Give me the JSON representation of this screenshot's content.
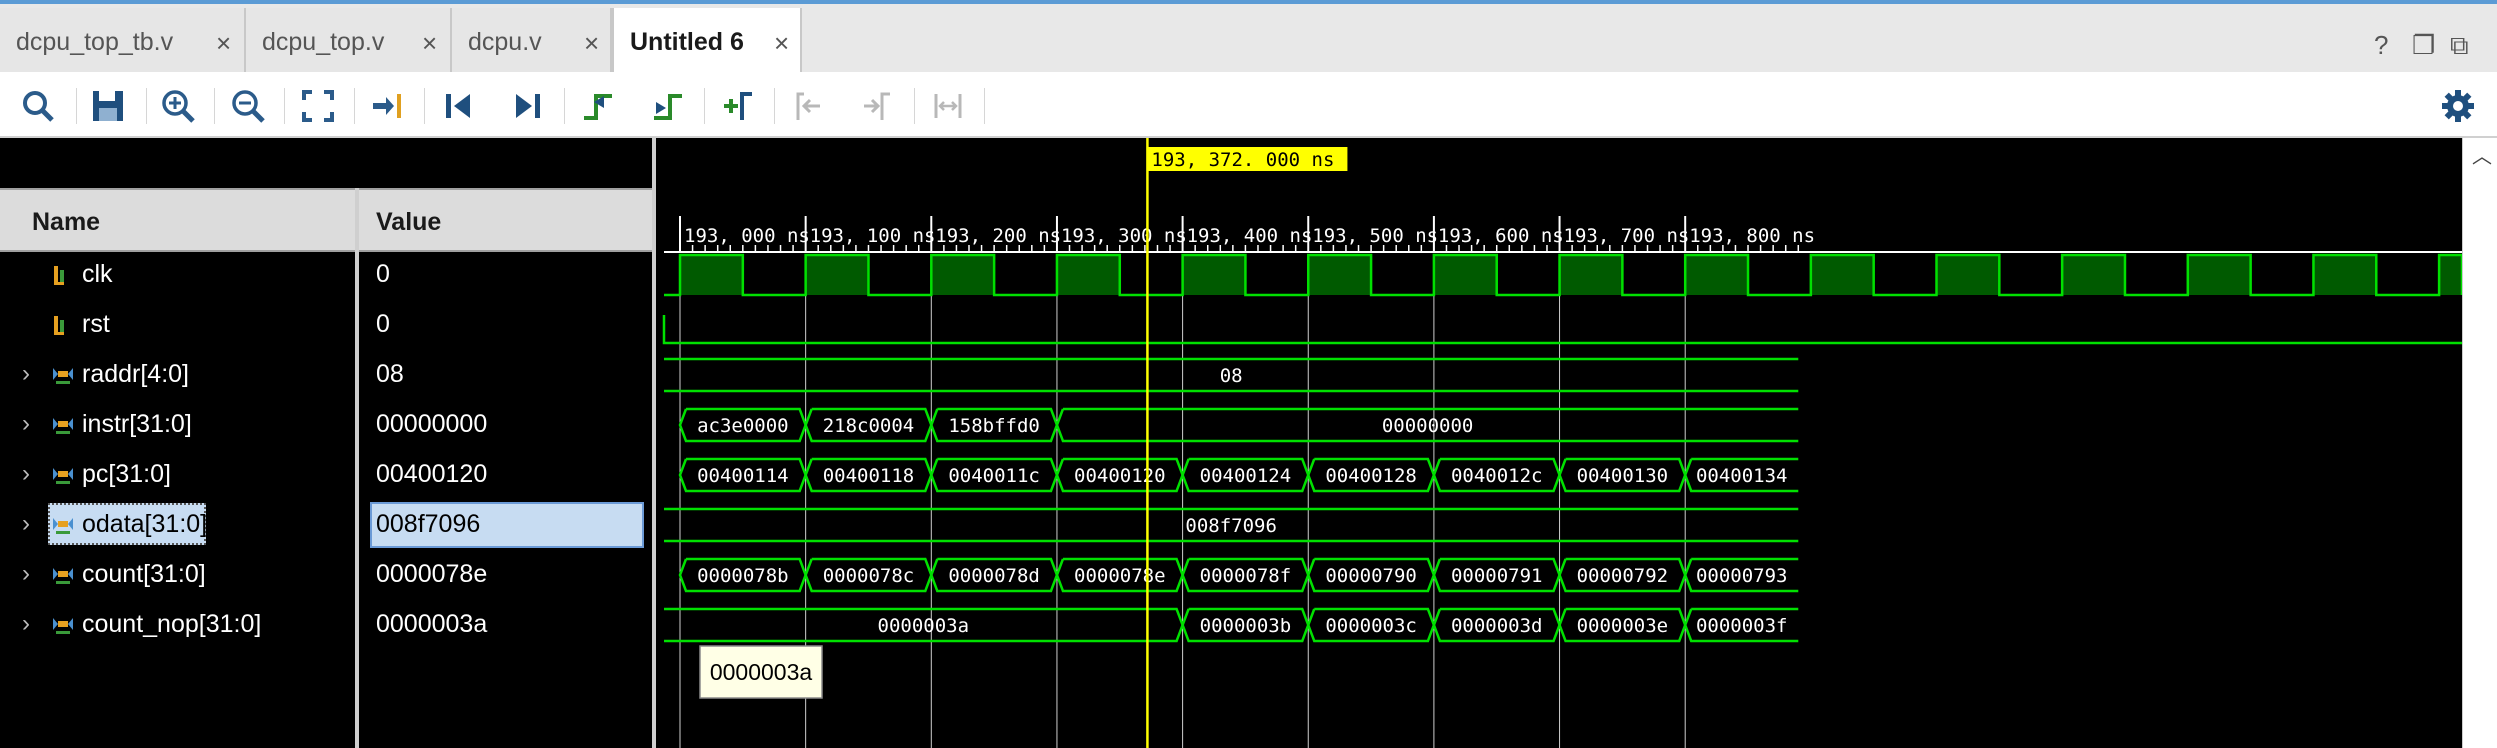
{
  "tabs": [
    {
      "label": "dcpu_top_tb.v",
      "active": false
    },
    {
      "label": "dcpu_top.v",
      "active": false
    },
    {
      "label": "dcpu.v",
      "active": false
    },
    {
      "label": "Untitled 6",
      "active": true
    }
  ],
  "tab_close_glyph": "×",
  "window_controls": {
    "help": "?",
    "restore": "❐",
    "float": "⧉"
  },
  "toolbar": [
    "search-icon",
    "save-icon",
    "zoom-in-icon",
    "zoom-out-icon",
    "zoom-fit-icon",
    "go-to-cursor-icon",
    "go-to-time-zero-icon",
    "go-to-last-time-icon",
    "previous-transition-icon",
    "next-transition-icon",
    "add-marker-icon",
    "previous-marker-icon",
    "next-marker-icon",
    "swap-cursors-icon",
    "settings-gear-icon"
  ],
  "columns": {
    "name": "Name",
    "value": "Value"
  },
  "signals": [
    {
      "name": "clk",
      "value": "0",
      "type": "bit",
      "expandable": false
    },
    {
      "name": "rst",
      "value": "0",
      "type": "bit",
      "expandable": false
    },
    {
      "name": "raddr[4:0]",
      "value": "08",
      "type": "bus",
      "expandable": true
    },
    {
      "name": "instr[31:0]",
      "value": "00000000",
      "type": "bus",
      "expandable": true
    },
    {
      "name": "pc[31:0]",
      "value": "00400120",
      "type": "bus",
      "expandable": true
    },
    {
      "name": "odata[31:0]",
      "value": "008f7096",
      "type": "bus",
      "expandable": true,
      "selected": true
    },
    {
      "name": "count[31:0]",
      "value": "0000078e",
      "type": "bus",
      "expandable": true
    },
    {
      "name": "count_nop[31:0]",
      "value": "0000003a",
      "type": "bus",
      "expandable": true
    }
  ],
  "timeline": {
    "unit": "ns",
    "ticks": [
      "193, 000 ns",
      "193, 100 ns",
      "193, 200 ns",
      "193, 300 ns",
      "193, 400 ns",
      "193, 500 ns",
      "193, 600 ns",
      "193, 700 ns",
      "193, 800 ns"
    ],
    "cursor": {
      "label": "193, 372. 000 ns",
      "time": 193372
    }
  },
  "waves": {
    "clk": {
      "period_ns": 50,
      "high_start": 193000
    },
    "rst": {
      "value": "0"
    },
    "raddr": [
      {
        "v": "08",
        "t0": 192980,
        "t1": 193890
      }
    ],
    "instr": [
      {
        "v": "ac3e0000",
        "t0": 193000,
        "t1": 193100
      },
      {
        "v": "218c0004",
        "t0": 193100,
        "t1": 193200
      },
      {
        "v": "158bffd0",
        "t0": 193200,
        "t1": 193300
      },
      {
        "v": "00000000",
        "t0": 193300,
        "t1": 193890
      }
    ],
    "pc": [
      {
        "v": "00400114",
        "t0": 193000,
        "t1": 193100
      },
      {
        "v": "00400118",
        "t0": 193100,
        "t1": 193200
      },
      {
        "v": "0040011c",
        "t0": 193200,
        "t1": 193300
      },
      {
        "v": "00400120",
        "t0": 193300,
        "t1": 193400
      },
      {
        "v": "00400124",
        "t0": 193400,
        "t1": 193500
      },
      {
        "v": "00400128",
        "t0": 193500,
        "t1": 193600
      },
      {
        "v": "0040012c",
        "t0": 193600,
        "t1": 193700
      },
      {
        "v": "00400130",
        "t0": 193700,
        "t1": 193800
      },
      {
        "v": "00400134",
        "t0": 193800,
        "t1": 193890
      }
    ],
    "odata": [
      {
        "v": "008f7096",
        "t0": 192980,
        "t1": 193890
      }
    ],
    "count": [
      {
        "v": "0000078b",
        "t0": 193000,
        "t1": 193100
      },
      {
        "v": "0000078c",
        "t0": 193100,
        "t1": 193200
      },
      {
        "v": "0000078d",
        "t0": 193200,
        "t1": 193300
      },
      {
        "v": "0000078e",
        "t0": 193300,
        "t1": 193400
      },
      {
        "v": "0000078f",
        "t0": 193400,
        "t1": 193500
      },
      {
        "v": "00000790",
        "t0": 193500,
        "t1": 193600
      },
      {
        "v": "00000791",
        "t0": 193600,
        "t1": 193700
      },
      {
        "v": "00000792",
        "t0": 193700,
        "t1": 193800
      },
      {
        "v": "00000793",
        "t0": 193800,
        "t1": 193890
      }
    ],
    "count_nop": [
      {
        "v": "0000003a",
        "t0": 192980,
        "t1": 193400
      },
      {
        "v": "0000003b",
        "t0": 193400,
        "t1": 193500
      },
      {
        "v": "0000003c",
        "t0": 193500,
        "t1": 193600
      },
      {
        "v": "0000003d",
        "t0": 193600,
        "t1": 193700
      },
      {
        "v": "0000003e",
        "t0": 193700,
        "t1": 193800
      },
      {
        "v": "0000003f",
        "t0": 193800,
        "t1": 193890
      }
    ]
  },
  "tooltip": "0000003a",
  "colors": {
    "wave": "#00e000",
    "clk_fill": "#005a00",
    "cursor": "#ffff00",
    "grid": "#ffffff",
    "selection": "#c7dcf2",
    "tab_accent": "#5b9bd5"
  }
}
